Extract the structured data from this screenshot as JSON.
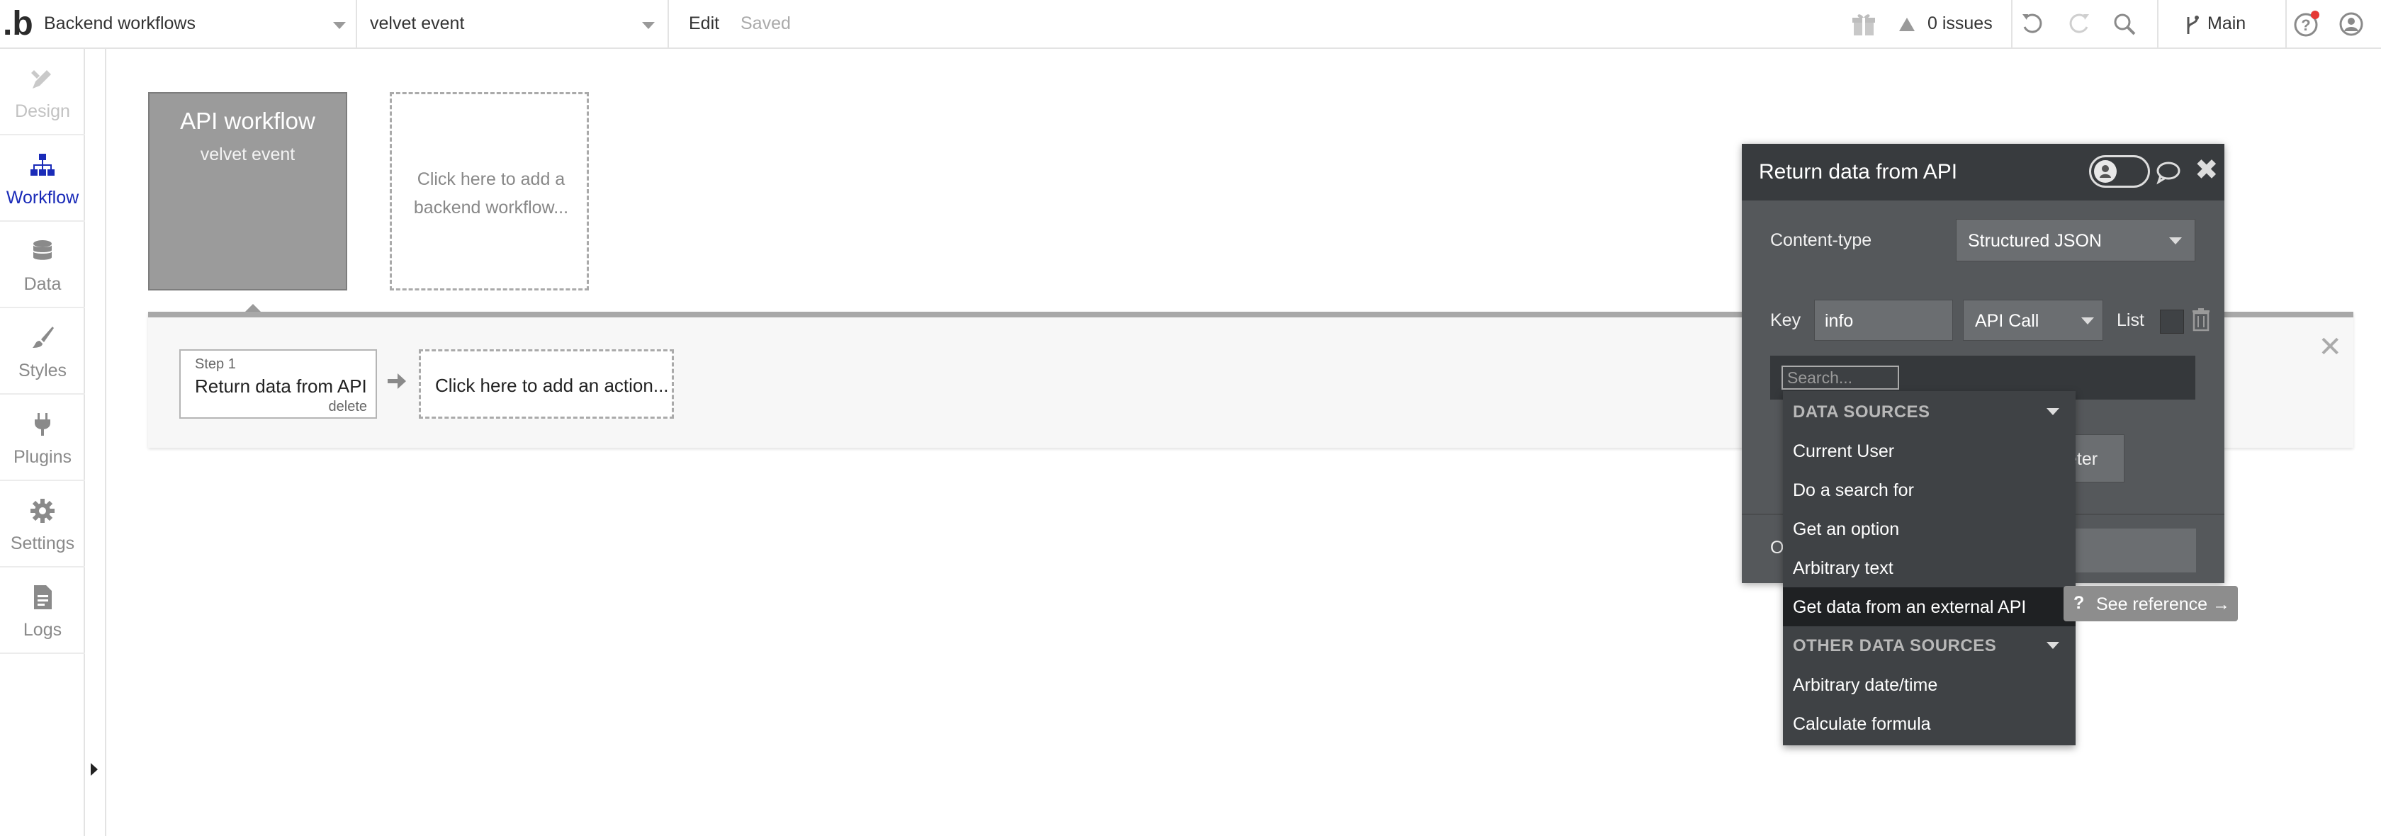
{
  "topbar": {
    "page_name": "Backend workflows",
    "workflow_name": "velvet event",
    "edit_label": "Edit",
    "saved_label": "Saved",
    "issues_label": "0 issues",
    "branch_label": "Main"
  },
  "sidebar": {
    "items": [
      {
        "label": "Design",
        "icon": "design-icon"
      },
      {
        "label": "Workflow",
        "icon": "workflow-icon"
      },
      {
        "label": "Data",
        "icon": "database-icon"
      },
      {
        "label": "Styles",
        "icon": "brush-icon"
      },
      {
        "label": "Plugins",
        "icon": "plug-icon"
      },
      {
        "label": "Settings",
        "icon": "gear-icon"
      },
      {
        "label": "Logs",
        "icon": "document-icon"
      }
    ]
  },
  "canvas": {
    "event_title": "API workflow",
    "event_name": "velvet event",
    "add_workflow_hint": "Click here to add a backend workflow..."
  },
  "actions": {
    "step_number": "Step 1",
    "step_name": "Return data from API",
    "step_delete": "delete",
    "add_action_hint": "Click here to add an action..."
  },
  "panel": {
    "title": "Return data from API",
    "content_type_label": "Content-type",
    "content_type_value": "Structured JSON",
    "key_label": "Key",
    "key_value": "info",
    "value_type": "API Call",
    "list_label": "List",
    "search_placeholder": "Search...",
    "partial_button_text": "eter",
    "partial_row_label": "O"
  },
  "menu": {
    "items": [
      {
        "label": "DATA SOURCES",
        "type": "header"
      },
      {
        "label": "Current User",
        "type": "item"
      },
      {
        "label": "Do a search for",
        "type": "item"
      },
      {
        "label": "Get an option",
        "type": "item"
      },
      {
        "label": "Arbitrary text",
        "type": "item"
      },
      {
        "label": "Get data from an external API",
        "type": "item",
        "highlighted": true
      },
      {
        "label": "OTHER DATA SOURCES",
        "type": "header"
      },
      {
        "label": "Arbitrary date/time",
        "type": "item"
      },
      {
        "label": "Calculate formula",
        "type": "item"
      }
    ],
    "reference_label": "See reference →",
    "reference_icon": "?"
  }
}
